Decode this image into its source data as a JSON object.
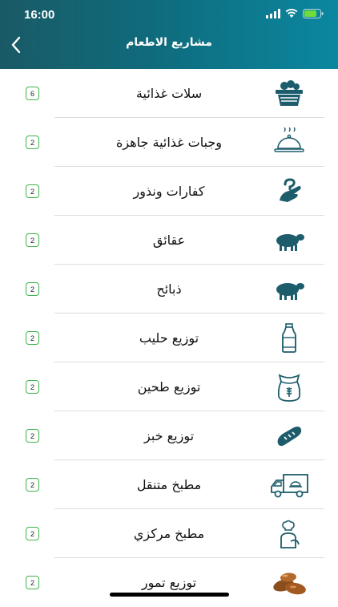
{
  "status_bar": {
    "time": "16:00"
  },
  "header": {
    "title": "مشاريع الاطعام"
  },
  "items": [
    {
      "label": "سلات غذائية",
      "count": "6",
      "icon": "food-basket-icon"
    },
    {
      "label": "وجبات غذائية جاهزة",
      "count": "2",
      "icon": "cloche-icon"
    },
    {
      "label": "كفارات ونذور",
      "count": "2",
      "icon": "hand-question-icon"
    },
    {
      "label": "عقائق",
      "count": "2",
      "icon": "sheep-icon"
    },
    {
      "label": "ذبائح",
      "count": "2",
      "icon": "sheep-icon"
    },
    {
      "label": "توزيع حليب",
      "count": "2",
      "icon": "milk-bottle-icon"
    },
    {
      "label": "توزيع طحين",
      "count": "2",
      "icon": "flour-sack-icon"
    },
    {
      "label": "توزيع خبز",
      "count": "2",
      "icon": "bread-icon"
    },
    {
      "label": "مطبخ متنقل",
      "count": "2",
      "icon": "food-truck-icon"
    },
    {
      "label": "مطبخ مركزي",
      "count": "2",
      "icon": "chef-icon"
    },
    {
      "label": "توزيع تمور",
      "count": "2",
      "icon": "dates-icon"
    }
  ],
  "colors": {
    "header_start": "#1a5a66",
    "header_end": "#0b87a0",
    "badge_border": "#3db54a",
    "icon": "#1d5d6b"
  }
}
